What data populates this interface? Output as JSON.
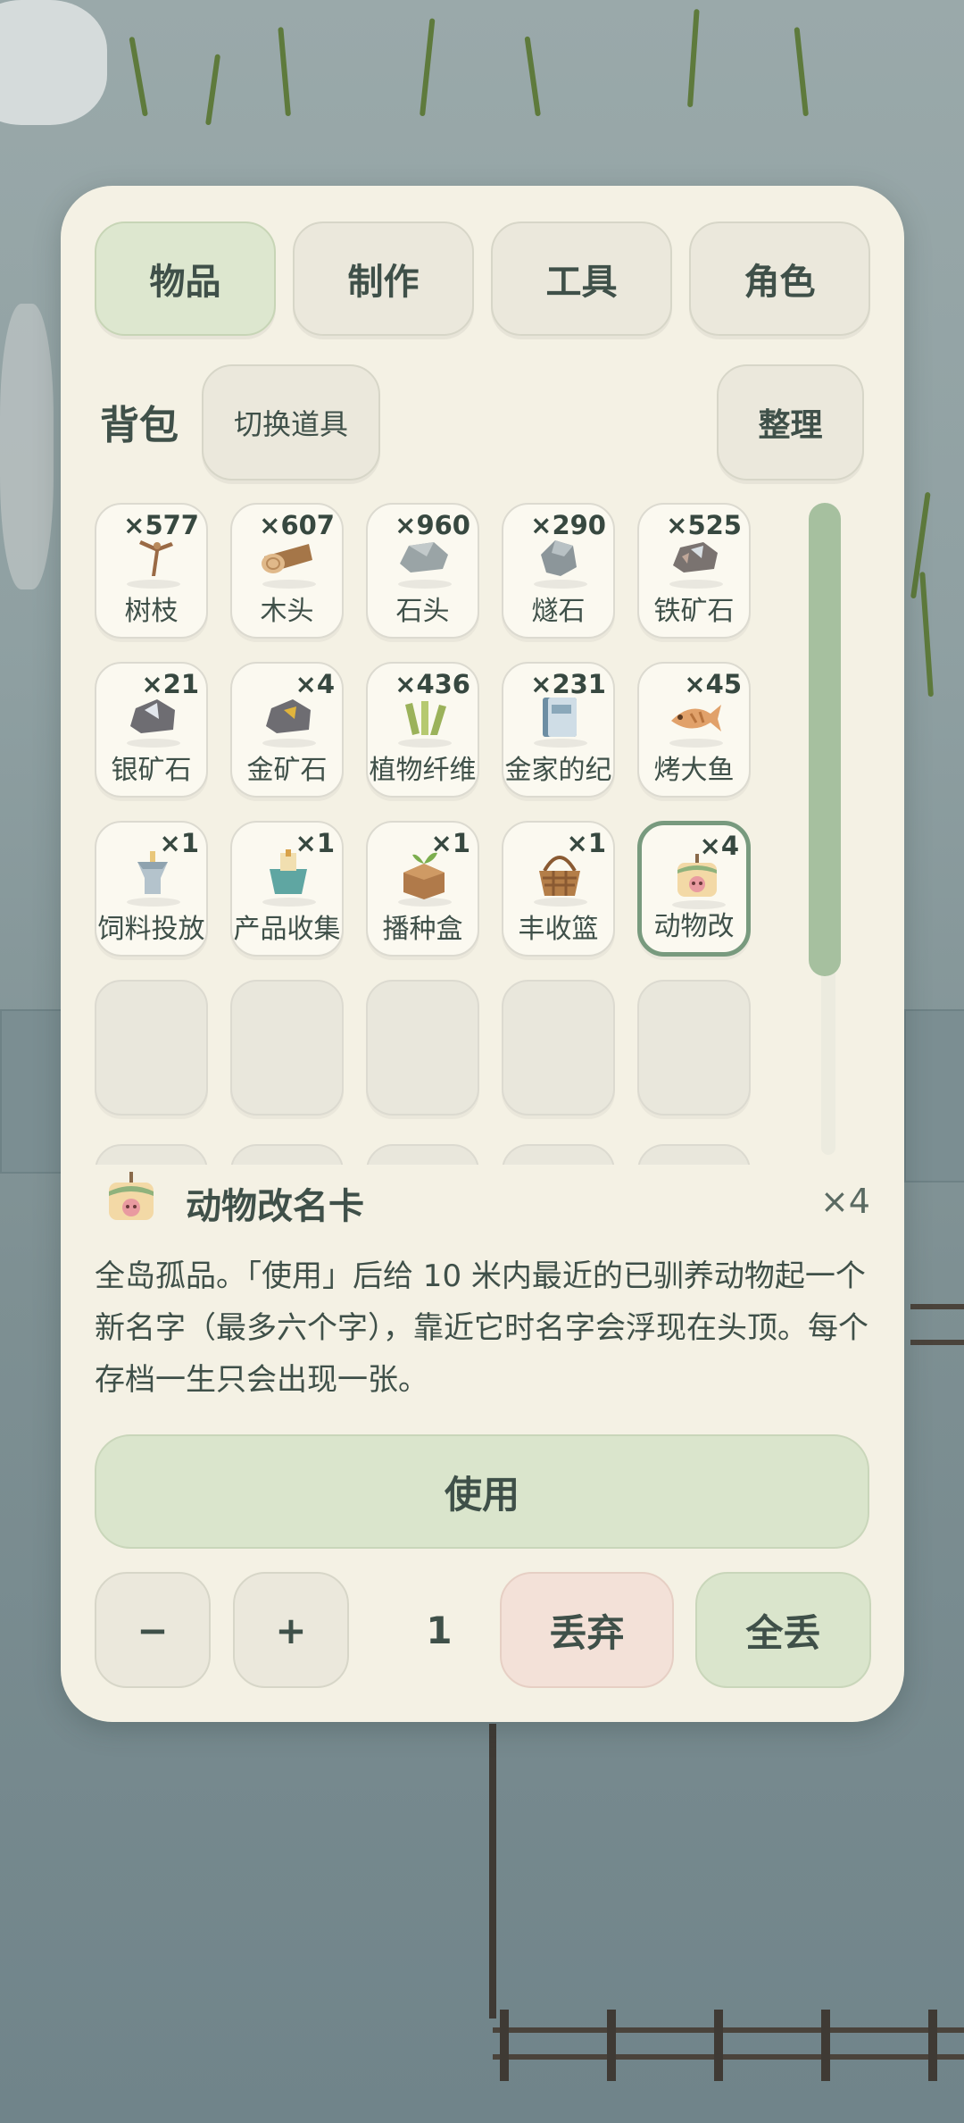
{
  "tabs": [
    {
      "label": "物品",
      "active": true
    },
    {
      "label": "制作",
      "active": false
    },
    {
      "label": "工具",
      "active": false
    },
    {
      "label": "角色",
      "active": false
    }
  ],
  "backpack": {
    "title": "背包",
    "switch_label": "切换道具",
    "sort_label": "整理"
  },
  "items": [
    {
      "name": "树枝",
      "qty": "×577",
      "icon": "branch-icon"
    },
    {
      "name": "木头",
      "qty": "×607",
      "icon": "log-icon"
    },
    {
      "name": "石头",
      "qty": "×960",
      "icon": "stone-icon"
    },
    {
      "name": "燧石",
      "qty": "×290",
      "icon": "flint-icon"
    },
    {
      "name": "铁矿石",
      "qty": "×525",
      "icon": "iron-ore-icon"
    },
    {
      "name": "银矿石",
      "qty": "×21",
      "icon": "silver-ore-icon"
    },
    {
      "name": "金矿石",
      "qty": "×4",
      "icon": "gold-ore-icon"
    },
    {
      "name": "植物纤维",
      "qty": "×436",
      "icon": "fiber-icon"
    },
    {
      "name": "金家的纪",
      "qty": "×231",
      "icon": "book-icon"
    },
    {
      "name": "烤大鱼",
      "qty": "×45",
      "icon": "fish-icon"
    },
    {
      "name": "饲料投放",
      "qty": "×1",
      "icon": "feeder-icon"
    },
    {
      "name": "产品收集",
      "qty": "×1",
      "icon": "collector-icon"
    },
    {
      "name": "播种盒",
      "qty": "×1",
      "icon": "seed-box-icon"
    },
    {
      "name": "丰收篮",
      "qty": "×1",
      "icon": "basket-icon"
    },
    {
      "name": "动物改",
      "qty": "×4",
      "icon": "rename-card-icon",
      "selected": true
    }
  ],
  "detail": {
    "title": "动物改名卡",
    "count": "×4",
    "description": "全岛孤品。「使用」后给 10 米内最近的已驯养动物起一个新名字（最多六个字），靠近它时名字会浮现在头顶。每个存档一生只会出现一张。",
    "use_label": "使用",
    "minus_label": "−",
    "plus_label": "+",
    "quantity": "1",
    "discard_label": "丢弃",
    "discard_all_label": "全丢"
  },
  "colors": {
    "panel": "#f4f1e4",
    "active_tab": "#dde7cf",
    "scroll_thumb": "#a6c09f",
    "discard": "#f3e1d8",
    "use": "#dae5cc",
    "text": "#3f5049"
  }
}
